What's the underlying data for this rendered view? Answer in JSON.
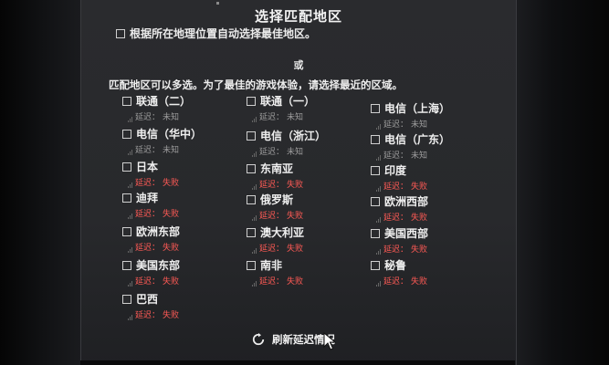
{
  "dialog": {
    "title": "选择匹配地区",
    "auto_select_label": "根据所在地理位置自动选择最佳地区。",
    "or_text": "或",
    "description": "匹配地区可以多选。为了最佳的游戏体验，请选择最近的区域。"
  },
  "latency_prefix": "延迟：",
  "regions": [
    {
      "name": "联通（二）",
      "latency": "未知",
      "status": "unknown"
    },
    {
      "name": "联通（一）",
      "latency": "未知",
      "status": "unknown"
    },
    {
      "name": "电信（上海）",
      "latency": "未知",
      "status": "unknown"
    },
    {
      "name": "电信（华中）",
      "latency": "未知",
      "status": "unknown"
    },
    {
      "name": "电信（浙江）",
      "latency": "未知",
      "status": "unknown"
    },
    {
      "name": "电信（广东）",
      "latency": "未知",
      "status": "unknown"
    },
    {
      "name": "日本",
      "latency": "失败",
      "status": "fail"
    },
    {
      "name": "东南亚",
      "latency": "失败",
      "status": "fail"
    },
    {
      "name": "印度",
      "latency": "失败",
      "status": "fail"
    },
    {
      "name": "迪拜",
      "latency": "失败",
      "status": "fail"
    },
    {
      "name": "俄罗斯",
      "latency": "失败",
      "status": "fail"
    },
    {
      "name": "欧洲西部",
      "latency": "失败",
      "status": "fail"
    },
    {
      "name": "欧洲东部",
      "latency": "失败",
      "status": "fail"
    },
    {
      "name": "澳大利亚",
      "latency": "失败",
      "status": "fail"
    },
    {
      "name": "美国西部",
      "latency": "失败",
      "status": "fail"
    },
    {
      "name": "美国东部",
      "latency": "失败",
      "status": "fail"
    },
    {
      "name": "南非",
      "latency": "失败",
      "status": "fail"
    },
    {
      "name": "秘鲁",
      "latency": "失败",
      "status": "fail"
    },
    {
      "name": "巴西",
      "latency": "失败",
      "status": "fail"
    }
  ],
  "refresh_button": {
    "label": "刷新延迟情况",
    "icon": "refresh-icon"
  },
  "colors": {
    "fail": "#ff5a55",
    "unknown": "#9c9c9c",
    "panel": "#2a2b2e"
  }
}
